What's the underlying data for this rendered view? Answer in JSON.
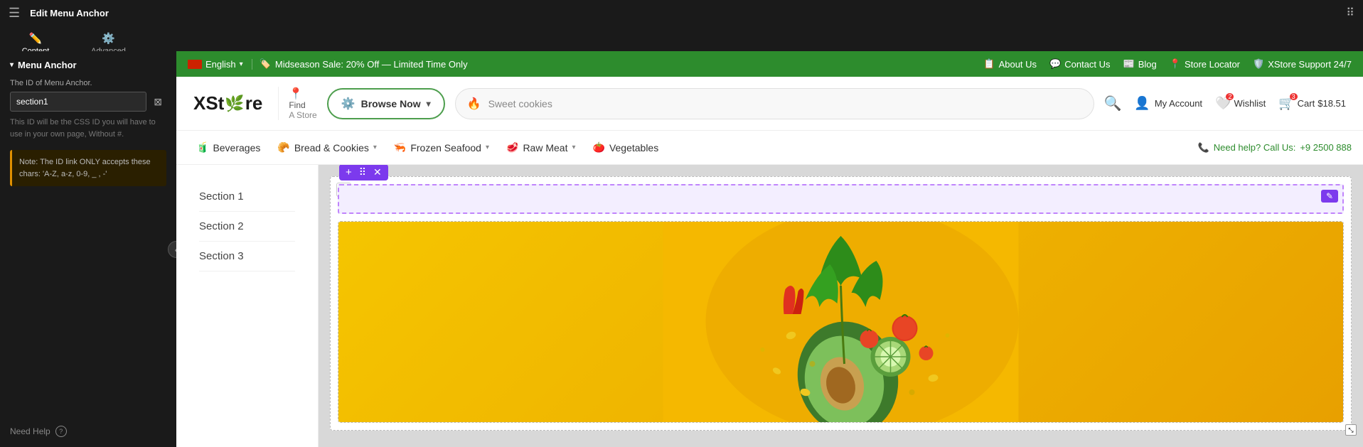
{
  "editor": {
    "title": "Edit Menu Anchor",
    "hamburger_icon": "☰",
    "grid_icon": "⠿",
    "tabs": [
      {
        "id": "content",
        "label": "Content",
        "icon": "✏️",
        "active": true
      },
      {
        "id": "advanced",
        "label": "Advanced",
        "icon": "⚙️",
        "active": false
      }
    ]
  },
  "sidebar": {
    "section_title": "Menu Anchor",
    "field_label": "The ID of Menu Anchor.",
    "field_value": "section1",
    "field_placeholder": "section1",
    "hint_text": "This ID will be the CSS ID you will have to use in your own page, Without #.",
    "note_text": "Note: The ID link ONLY accepts these chars: 'A-Z, a-z, 0-9, _ , -'",
    "need_help": "Need Help",
    "collapse_icon": "‹"
  },
  "top_bar": {
    "lang": "English",
    "flag_url": "",
    "sale_text": "Midseason Sale: 20% Off — Limited Time Only",
    "about_us": "About Us",
    "contact_us": "Contact Us",
    "blog": "Blog",
    "store_locator": "Store Locator",
    "support": "XStore Support 24/7"
  },
  "store_header": {
    "logo_text": "XSt",
    "logo_leaf": "🌿",
    "logo_rest": "re",
    "find_label": "Find",
    "store_label": "A Store",
    "browse_label": "Browse Now",
    "search_placeholder": "Sweet cookies",
    "my_account": "My Account",
    "wishlist": "Wishlist",
    "wishlist_count": "2",
    "cart": "Cart",
    "cart_amount": "$18.51",
    "cart_count": "3"
  },
  "nav": {
    "items": [
      {
        "id": "beverages",
        "icon": "🧃",
        "label": "Beverages",
        "has_dropdown": false
      },
      {
        "id": "bread",
        "icon": "🥐",
        "label": "Bread & Cookies",
        "has_dropdown": true
      },
      {
        "id": "frozen",
        "icon": "🦐",
        "label": "Frozen Seafood",
        "has_dropdown": true
      },
      {
        "id": "raw-meat",
        "icon": "🥩",
        "label": "Raw Meat",
        "has_dropdown": true
      },
      {
        "id": "vegetables",
        "icon": "🍅",
        "label": "Vegetables",
        "has_dropdown": false
      }
    ],
    "help_text": "Need help? Call Us:",
    "phone": "+9 2500 888",
    "phone_icon": "📞"
  },
  "page_content": {
    "left_nav_items": [
      {
        "id": "section1",
        "label": "Section 1"
      },
      {
        "id": "section2",
        "label": "Section 2"
      },
      {
        "id": "section3",
        "label": "Section 3"
      }
    ]
  },
  "canvas": {
    "element_toolbar_buttons": [
      "+",
      "⠿",
      "✕"
    ],
    "edit_icon": "✎"
  }
}
